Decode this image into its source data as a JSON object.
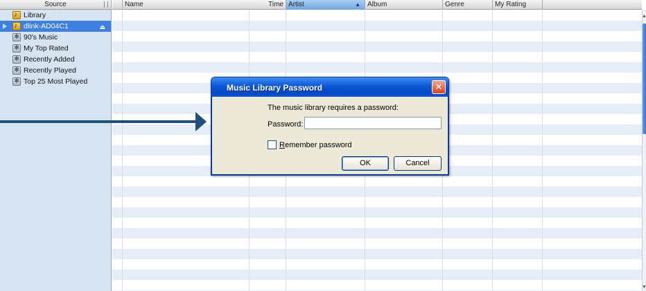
{
  "sidebar": {
    "header": "Source",
    "items": [
      {
        "label": "Library",
        "icon": "library-icon"
      },
      {
        "label": "dlink-AD04C1",
        "icon": "device-icon",
        "selected": true
      },
      {
        "label": "90's Music",
        "icon": "smart-playlist-icon"
      },
      {
        "label": "My Top Rated",
        "icon": "smart-playlist-icon"
      },
      {
        "label": "Recently Added",
        "icon": "smart-playlist-icon"
      },
      {
        "label": "Recently Played",
        "icon": "smart-playlist-icon"
      },
      {
        "label": "Top 25 Most Played",
        "icon": "smart-playlist-icon"
      }
    ]
  },
  "columns": {
    "name": "Name",
    "time": "Time",
    "artist": "Artist",
    "album": "Album",
    "genre": "Genre",
    "rating": "My Rating"
  },
  "dialog": {
    "title": "Music Library Password",
    "message": "The music library requires a password:",
    "password_label": "Password:",
    "password_value": "",
    "remember_accesskey": "R",
    "remember_rest": "emember password",
    "remember_checked": false,
    "ok_label": "OK",
    "cancel_label": "Cancel"
  },
  "colors": {
    "selected_source": "#3d80df",
    "title_bar": "#0a58d6",
    "arrow": "#1f4f7c",
    "row_stripe": "#e6edf7"
  }
}
